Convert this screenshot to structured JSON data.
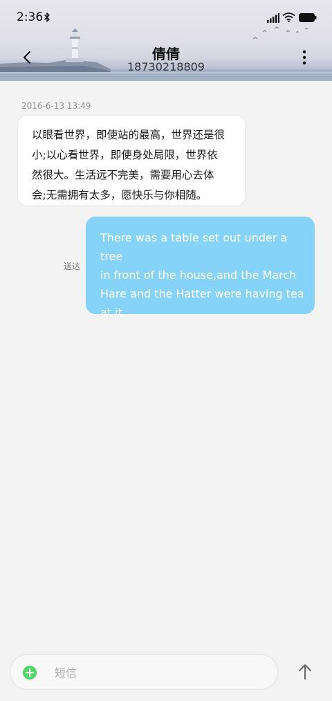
{
  "status_bar": {
    "time": "2:36",
    "icons": [
      "bluetooth-icon",
      "signal-icon",
      "wifi-icon",
      "battery-icon"
    ]
  },
  "header": {
    "contact_name": "倩倩",
    "phone_number": "18730218809",
    "icons": [
      "back-icon",
      "more-icon"
    ]
  },
  "conversation": {
    "timestamp": "2016-6-13 13:49",
    "messages": [
      {
        "direction": "incoming",
        "lines": [
          "以眼看世界，即使站的最高，世界还是很",
          "小;以心看世界，即使身处局限，世界依",
          "然很大。生活远不完美，需要用心去体",
          "会;无需拥有太多，愿快乐与你相随。"
        ]
      },
      {
        "direction": "outgoing",
        "status": "送达",
        "lines": [
          "There was a table set out under a tree",
          "in front of the house,and the March",
          "Hare and the Hatter were having tea",
          "at it."
        ]
      }
    ]
  },
  "composer": {
    "placeholder": "短信",
    "value": "",
    "icons": [
      "add-icon",
      "send-arrow-icon"
    ]
  },
  "colors": {
    "incoming_bubble": "#ffffff",
    "outgoing_bubble": "#86d3fa",
    "outgoing_text": "#ffffff",
    "add_button": "#4cd964",
    "background": "#f3f3f3"
  }
}
